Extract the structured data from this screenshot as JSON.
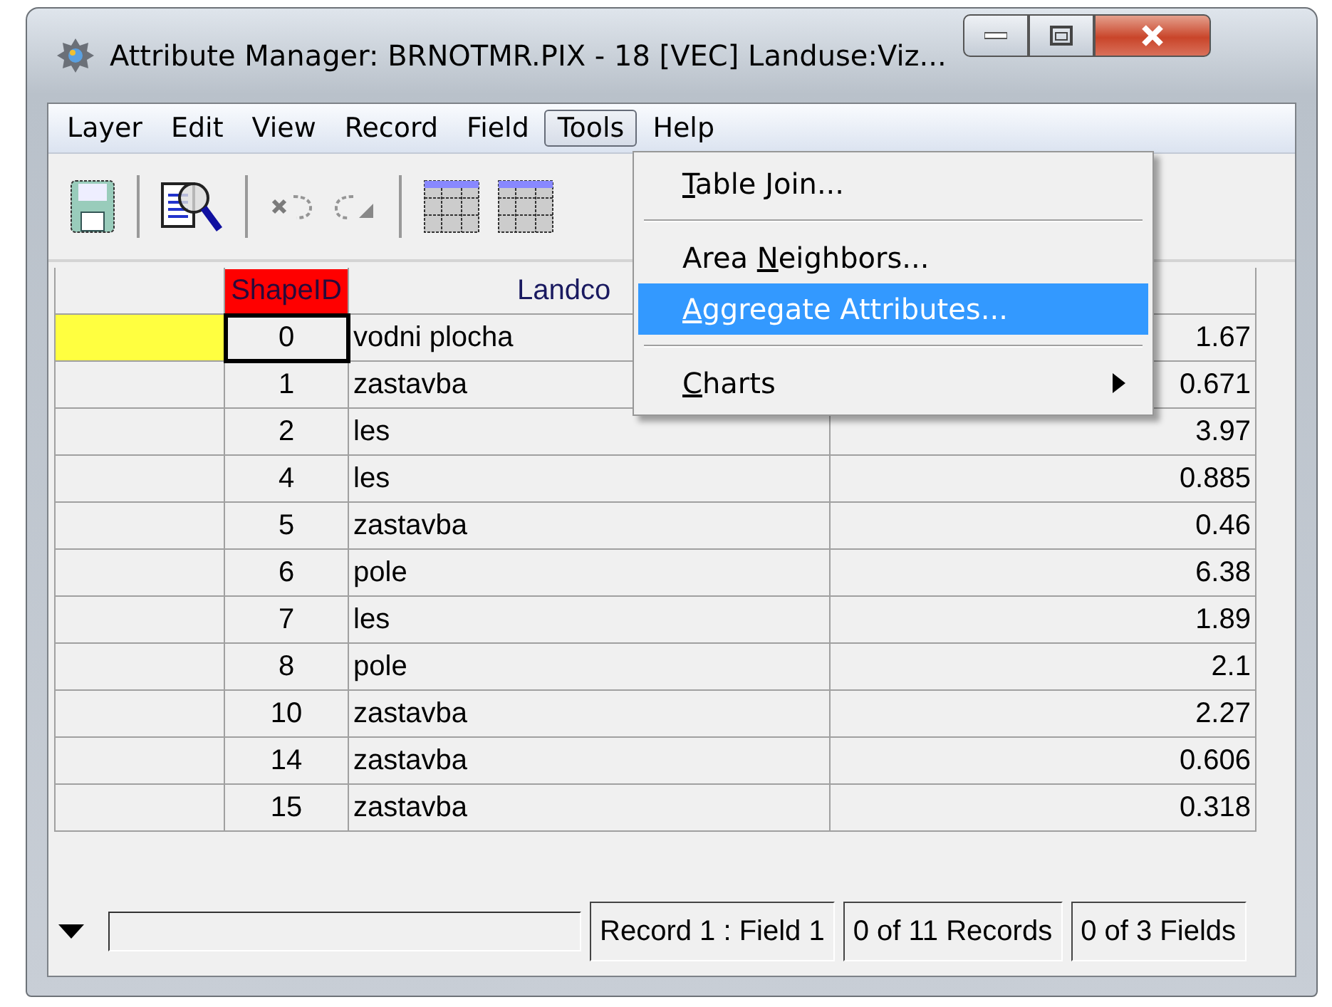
{
  "window": {
    "title": "Attribute Manager: BRNOTMR.PIX - 18 [VEC] Landuse:Viz..."
  },
  "menu_bar": [
    {
      "label": "Layer",
      "selected": false
    },
    {
      "label": "Edit",
      "selected": false
    },
    {
      "label": "View",
      "selected": false
    },
    {
      "label": "Record",
      "selected": false
    },
    {
      "label": "Field",
      "selected": false
    },
    {
      "label": "Tools",
      "selected": true
    },
    {
      "label": "Help",
      "selected": false
    }
  ],
  "toolbar": [
    {
      "kind": "save",
      "disabled": false
    },
    {
      "kind": "separator"
    },
    {
      "kind": "preview",
      "disabled": false
    },
    {
      "kind": "separator"
    },
    {
      "kind": "undo",
      "disabled": true
    },
    {
      "kind": "redo",
      "disabled": true
    },
    {
      "kind": "separator"
    },
    {
      "kind": "grid",
      "disabled": false
    },
    {
      "kind": "grid",
      "disabled": false
    }
  ],
  "table": {
    "columns": [
      {
        "label": "ShapeID",
        "highlighted": true
      },
      {
        "label": "Landco",
        "highlighted": false
      }
    ],
    "rows": [
      {
        "current": true,
        "cells": [
          "0",
          "vodni plocha",
          "1.67"
        ]
      },
      {
        "current": false,
        "cells": [
          "1",
          "zastavba",
          "0.671"
        ]
      },
      {
        "current": false,
        "cells": [
          "2",
          "les",
          "3.97"
        ]
      },
      {
        "current": false,
        "cells": [
          "4",
          "les",
          "0.885"
        ]
      },
      {
        "current": false,
        "cells": [
          "5",
          "zastavba",
          "0.46"
        ]
      },
      {
        "current": false,
        "cells": [
          "6",
          "pole",
          "6.38"
        ]
      },
      {
        "current": false,
        "cells": [
          "7",
          "les",
          "1.89"
        ]
      },
      {
        "current": false,
        "cells": [
          "8",
          "pole",
          "2.1"
        ]
      },
      {
        "current": false,
        "cells": [
          "10",
          "zastavba",
          "2.27"
        ]
      },
      {
        "current": false,
        "cells": [
          "14",
          "zastavba",
          "0.606"
        ]
      },
      {
        "current": false,
        "cells": [
          "15",
          "zastavba",
          "0.318"
        ]
      }
    ]
  },
  "dropdown": {
    "items": [
      {
        "kind": "item",
        "key": "T",
        "post": "able Join...",
        "selected": false,
        "submenu": false
      },
      {
        "kind": "separator"
      },
      {
        "kind": "item",
        "pre": "Area ",
        "key": "N",
        "post": "eighbors...",
        "selected": false,
        "submenu": false
      },
      {
        "kind": "item",
        "key": "A",
        "post": "ggregate Attributes...",
        "selected": true,
        "submenu": false
      },
      {
        "kind": "separator"
      },
      {
        "kind": "item",
        "key": "C",
        "post": "harts",
        "selected": false,
        "submenu": true
      }
    ]
  },
  "status_bar": {
    "fields": [
      "Record 1 : Field 1",
      "0 of 11 Records",
      "0 of 3 Fields"
    ]
  }
}
